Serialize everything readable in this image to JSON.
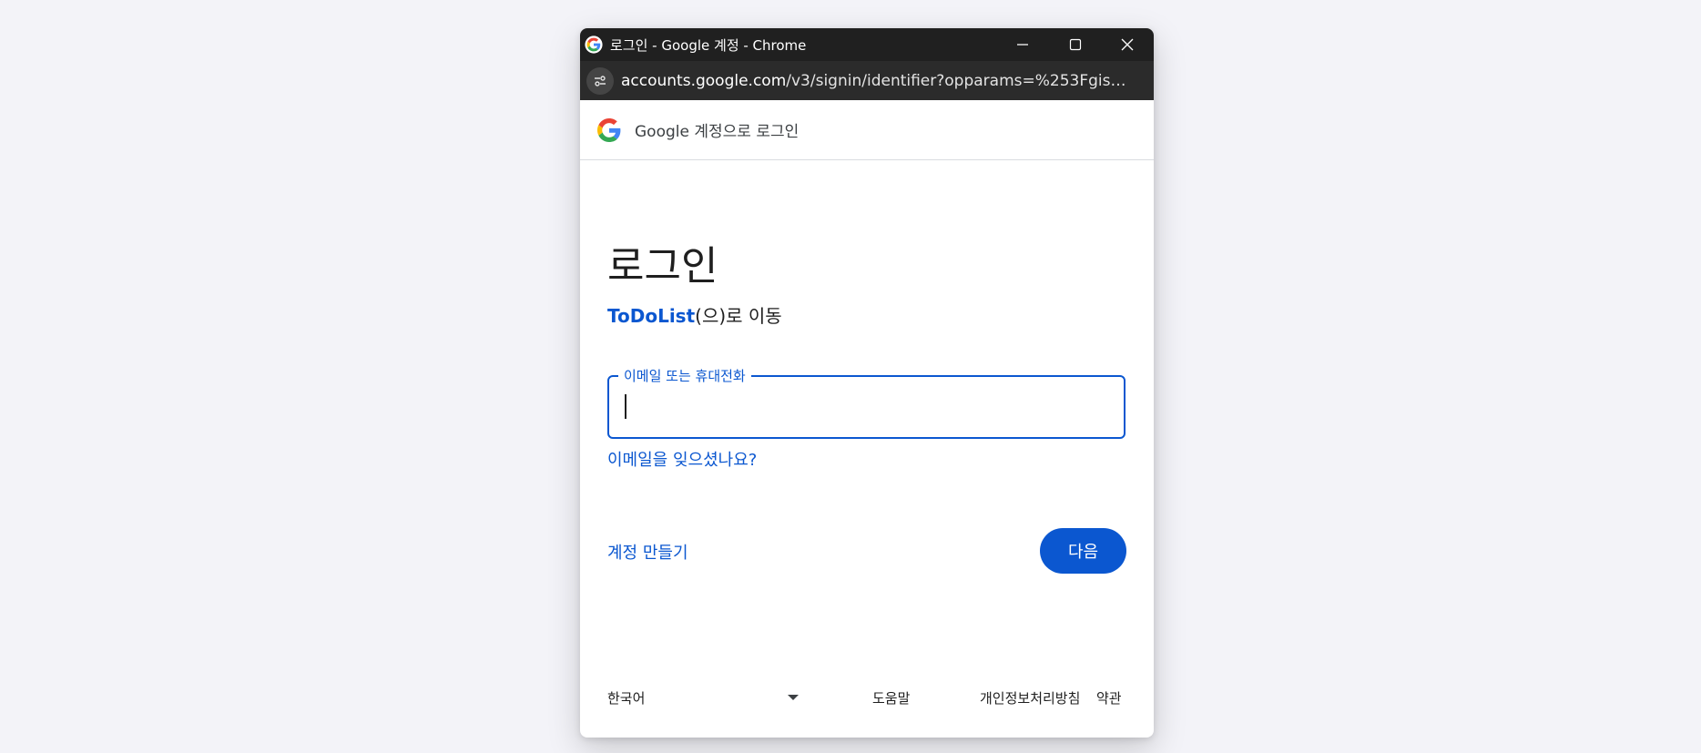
{
  "window": {
    "title": "로그인 - Google 계정 - Chrome",
    "url_host": "accounts.google.com",
    "url_rest": "/v3/signin/identifier?opparams=%253Fgis_para..."
  },
  "header": {
    "brand": "Google",
    "text": " 계정으로 로그인"
  },
  "main": {
    "heading": "로그인",
    "app_name": "ToDoList",
    "subtitle_rest": "(으)로 이동",
    "email_label": "이메일 또는 휴대전화",
    "email_value": "",
    "forgot_email": "이메일을 잊으셨나요?",
    "create_account": "계정 만들기",
    "next_button": "다음"
  },
  "footer": {
    "language": "한국어",
    "help": "도움말",
    "privacy": "개인정보처리방침",
    "terms": "약관"
  },
  "colors": {
    "accent": "#0b57d0",
    "titlebar": "#202020",
    "addressbar": "#2b2b2b"
  },
  "icons": {
    "title_logo": "google-g-icon",
    "site_info": "tune-icon",
    "minimize": "minimize-icon",
    "maximize": "maximize-icon",
    "close": "close-icon",
    "language_dropdown": "caret-down-icon"
  }
}
